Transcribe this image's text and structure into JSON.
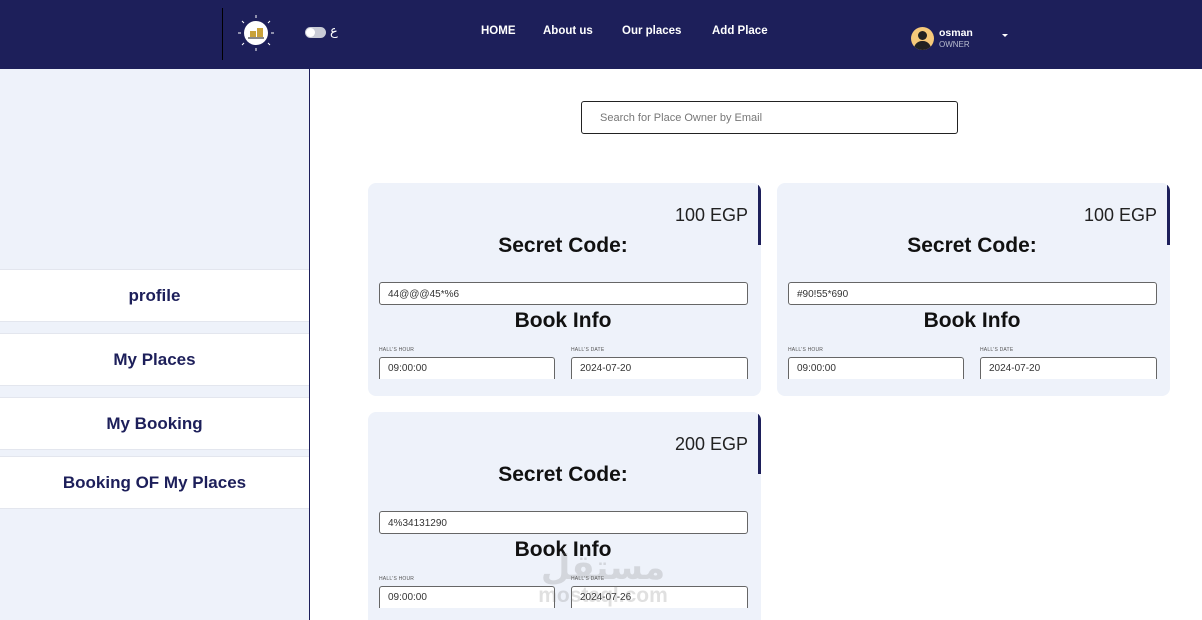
{
  "header": {
    "lang_label": "ع",
    "nav": [
      "HOME",
      "About us",
      "Our places",
      "Add Place"
    ],
    "user": {
      "name": "osman",
      "role": "OWNER"
    }
  },
  "sidebar": {
    "items": [
      {
        "label": "profile"
      },
      {
        "label": "My Places"
      },
      {
        "label": "My Booking"
      },
      {
        "label": "Booking OF My Places"
      }
    ]
  },
  "search": {
    "placeholder": "Search for Place Owner by Email",
    "value": ""
  },
  "cards": [
    {
      "price": "100 EGP",
      "secret_title": "Secret Code:",
      "secret_code": "44@@@45*%6",
      "book_title": "Book Info",
      "hour_label": "HALL'S HOUR",
      "hour": "09:00:00",
      "date_label": "HALL'S DATE",
      "date": "2024-07-20"
    },
    {
      "price": "100 EGP",
      "secret_title": "Secret Code:",
      "secret_code": "#90!55*690",
      "book_title": "Book Info",
      "hour_label": "HALL'S HOUR",
      "hour": "09:00:00",
      "date_label": "HALL'S DATE",
      "date": "2024-07-20"
    },
    {
      "price": "200 EGP",
      "secret_title": "Secret Code:",
      "secret_code": "4%34131290",
      "book_title": "Book Info",
      "hour_label": "HALL'S HOUR",
      "hour": "09:00:00",
      "date_label": "HALL'S DATE",
      "date": "2024-07-26"
    }
  ],
  "watermark": {
    "arabic": "مستقل",
    "latin": "mostaql.com"
  },
  "colors": {
    "navy": "#1d1f5a",
    "card_bg": "#eef2fa",
    "sidebar_bg": "#eef2fa",
    "avatar": "#f6c97a"
  }
}
